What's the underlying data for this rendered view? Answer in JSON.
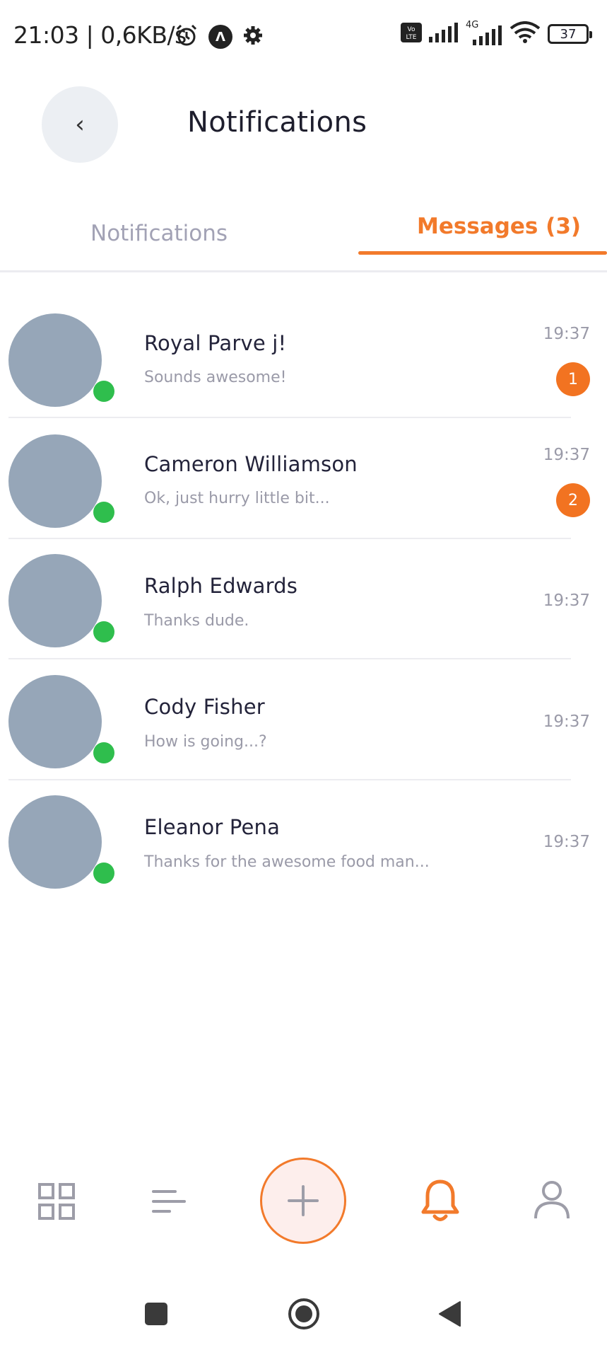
{
  "status_bar": {
    "time_speed": "21:03 | 0,6KB/s",
    "network_label": "4G",
    "battery": "37",
    "icons": [
      "alarm-icon",
      "app-icon",
      "settings-icon",
      "volte-icon",
      "signal-icon",
      "signal-4g-icon",
      "wifi-icon",
      "battery-icon"
    ]
  },
  "header": {
    "back_icon": "‹",
    "title": "Notifications"
  },
  "tabs": [
    {
      "label": "Notifications",
      "active": false
    },
    {
      "label": "Messages (3)",
      "active": true
    }
  ],
  "messages": [
    {
      "name": "Royal Parve j!",
      "preview": "Sounds awesome!",
      "time": "19:37",
      "unread": "1",
      "online": true
    },
    {
      "name": "Cameron Williamson",
      "preview": "Ok, just hurry little bit...",
      "time": "19:37",
      "unread": "2",
      "online": true
    },
    {
      "name": "Ralph Edwards",
      "preview": "Thanks dude.",
      "time": "19:37",
      "unread": "",
      "online": true
    },
    {
      "name": "Cody Fisher",
      "preview": "How is going...?",
      "time": "19:37",
      "unread": "",
      "online": true
    },
    {
      "name": "Eleanor Pena",
      "preview": "Thanks for the awesome food man...",
      "time": "19:37",
      "unread": "",
      "online": true
    }
  ],
  "bottom_nav": {
    "items": [
      "grid-icon",
      "list-icon",
      "add-icon",
      "bell-icon",
      "profile-icon"
    ],
    "active": "bell-icon"
  },
  "colors": {
    "accent": "#f27a2b",
    "online": "#2fbe4d",
    "avatar": "#96a6b8",
    "muted": "#9a9aa8"
  }
}
